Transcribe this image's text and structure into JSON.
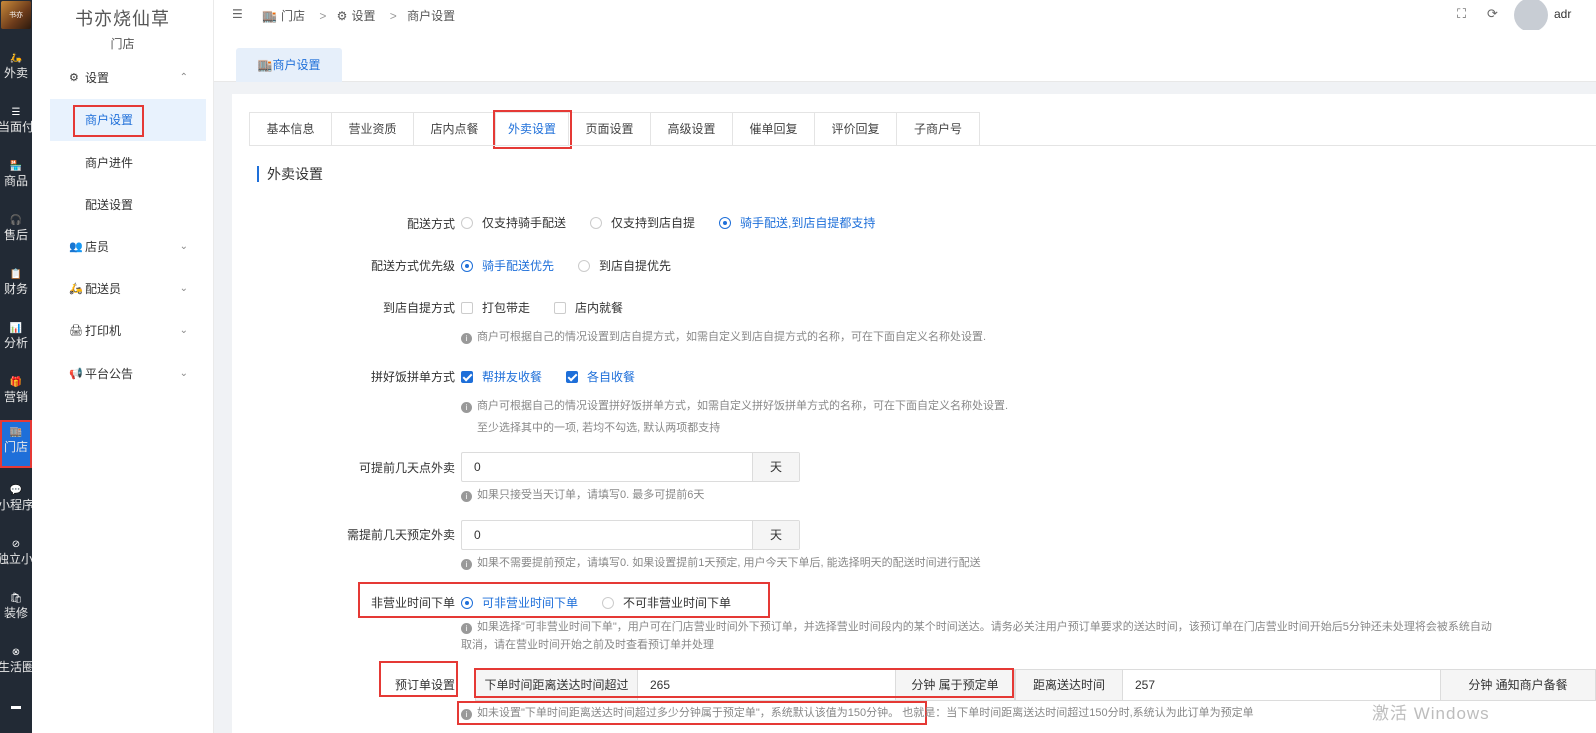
{
  "rail": {
    "logo_text": "书亦",
    "items": [
      {
        "icon": "🛵",
        "label": "外卖"
      },
      {
        "icon": "☰",
        "label": "当面付"
      },
      {
        "icon": "🏪",
        "label": "商品"
      },
      {
        "icon": "🎧",
        "label": "售后"
      },
      {
        "icon": "📋",
        "label": "财务"
      },
      {
        "icon": "📊",
        "label": "分析"
      },
      {
        "icon": "🎁",
        "label": "营销"
      },
      {
        "icon": "🏬",
        "label": "门店"
      },
      {
        "icon": "💬",
        "label": "小程序"
      },
      {
        "icon": "⊘",
        "label": "独立小程序"
      },
      {
        "icon": "🛍",
        "label": "装修"
      },
      {
        "icon": "⊗",
        "label": "生活圈"
      },
      {
        "icon": "▬",
        "label": ""
      }
    ]
  },
  "sidebar": {
    "store_name": "书亦烧仙草",
    "store_sub": "门店",
    "groups": [
      {
        "icon": "⚙",
        "label": "设置",
        "chevron": "⌃"
      },
      {
        "icon": "👥",
        "label": "店员",
        "chevron": "⌄"
      },
      {
        "icon": "🛵",
        "label": "配送员",
        "chevron": "⌄"
      },
      {
        "icon": "🖨",
        "label": "打印机",
        "chevron": "⌄"
      },
      {
        "icon": "📢",
        "label": "平台公告",
        "chevron": "⌄"
      }
    ],
    "subs": [
      {
        "label": "商户设置"
      },
      {
        "label": "商户进件"
      },
      {
        "label": "配送设置"
      }
    ]
  },
  "header": {
    "fold_icon": "☰",
    "breadcrumb": [
      "门店",
      "设置",
      "商户设置"
    ],
    "user_name": "adr"
  },
  "page_tab": "商户设置",
  "tabs": [
    "基本信息",
    "营业资质",
    "店内点餐",
    "外卖设置",
    "页面设置",
    "高级设置",
    "催单回复",
    "评价回复",
    "子商户号"
  ],
  "section_title": "外卖设置",
  "form": {
    "delivery_method": {
      "label": "配送方式",
      "options": [
        "仅支持骑手配送",
        "仅支持到店自提",
        "骑手配送,到店自提都支持"
      ]
    },
    "delivery_priority": {
      "label": "配送方式优先级",
      "options": [
        "骑手配送优先",
        "到店自提优先"
      ]
    },
    "pickup_method": {
      "label": "到店自提方式",
      "options": [
        "打包带走",
        "店内就餐"
      ],
      "hint": "商户可根据自己的情况设置到店自提方式，如需自定义到店自提方式的名称，可在下面自定义名称处设置."
    },
    "group_order": {
      "label": "拼好饭拼单方式",
      "options": [
        "帮拼友收餐",
        "各自收餐"
      ],
      "hint1": "商户可根据自己的情况设置拼好饭拼单方式，如需自定义拼好饭拼单方式的名称，可在下面自定义名称处设置.",
      "hint2": "至少选择其中的一项, 若均不勾选, 默认两项都支持"
    },
    "advance_days": {
      "label": "可提前几天点外卖",
      "value": "0",
      "unit": "天",
      "hint": "如果只接受当天订单，请填写0. 最多可提前6天"
    },
    "preorder_days": {
      "label": "需提前几天预定外卖",
      "value": "0",
      "unit": "天",
      "hint": "如果不需要提前预定，请填写0. 如果设置提前1天预定, 用户今天下单后, 能选择明天的配送时间进行配送"
    },
    "off_hours": {
      "label": "非营业时间下单",
      "options": [
        "可非营业时间下单",
        "不可非营业时间下单"
      ],
      "hint1": "如果选择\"可非营业时间下单\"，用户可在门店营业时间外下预订单，并选择营业时间段内的某个时间送达。请务必关注用户预订单要求的送达时间，该预订单在门店营业时间开始后5分钟还未处理将会被系统自动",
      "hint2": "取消，请在营业时间开始之前及时查看预订单并处理"
    },
    "preorder": {
      "label": "预订单设置",
      "prefix1": "下单时间距离送达时间超过",
      "value1": "265",
      "suffix1": "分钟 属于预定单",
      "prefix2": "距离送达时间",
      "value2": "257",
      "suffix2": "分钟 通知商户备餐",
      "hint_a": "如未设置\"下单时间距离送达时间超过多少分钟属于预定单\"，系统默认该值为150分钟。",
      "hint_b": "也就是：当下单时间距离送达时间超过150分时,系统认为此订单为预定单"
    }
  },
  "watermark": "激活 Windows",
  "colors": {
    "accent": "#1e6fd9",
    "highlight": "#e53935",
    "rail_bg": "#222a35"
  }
}
